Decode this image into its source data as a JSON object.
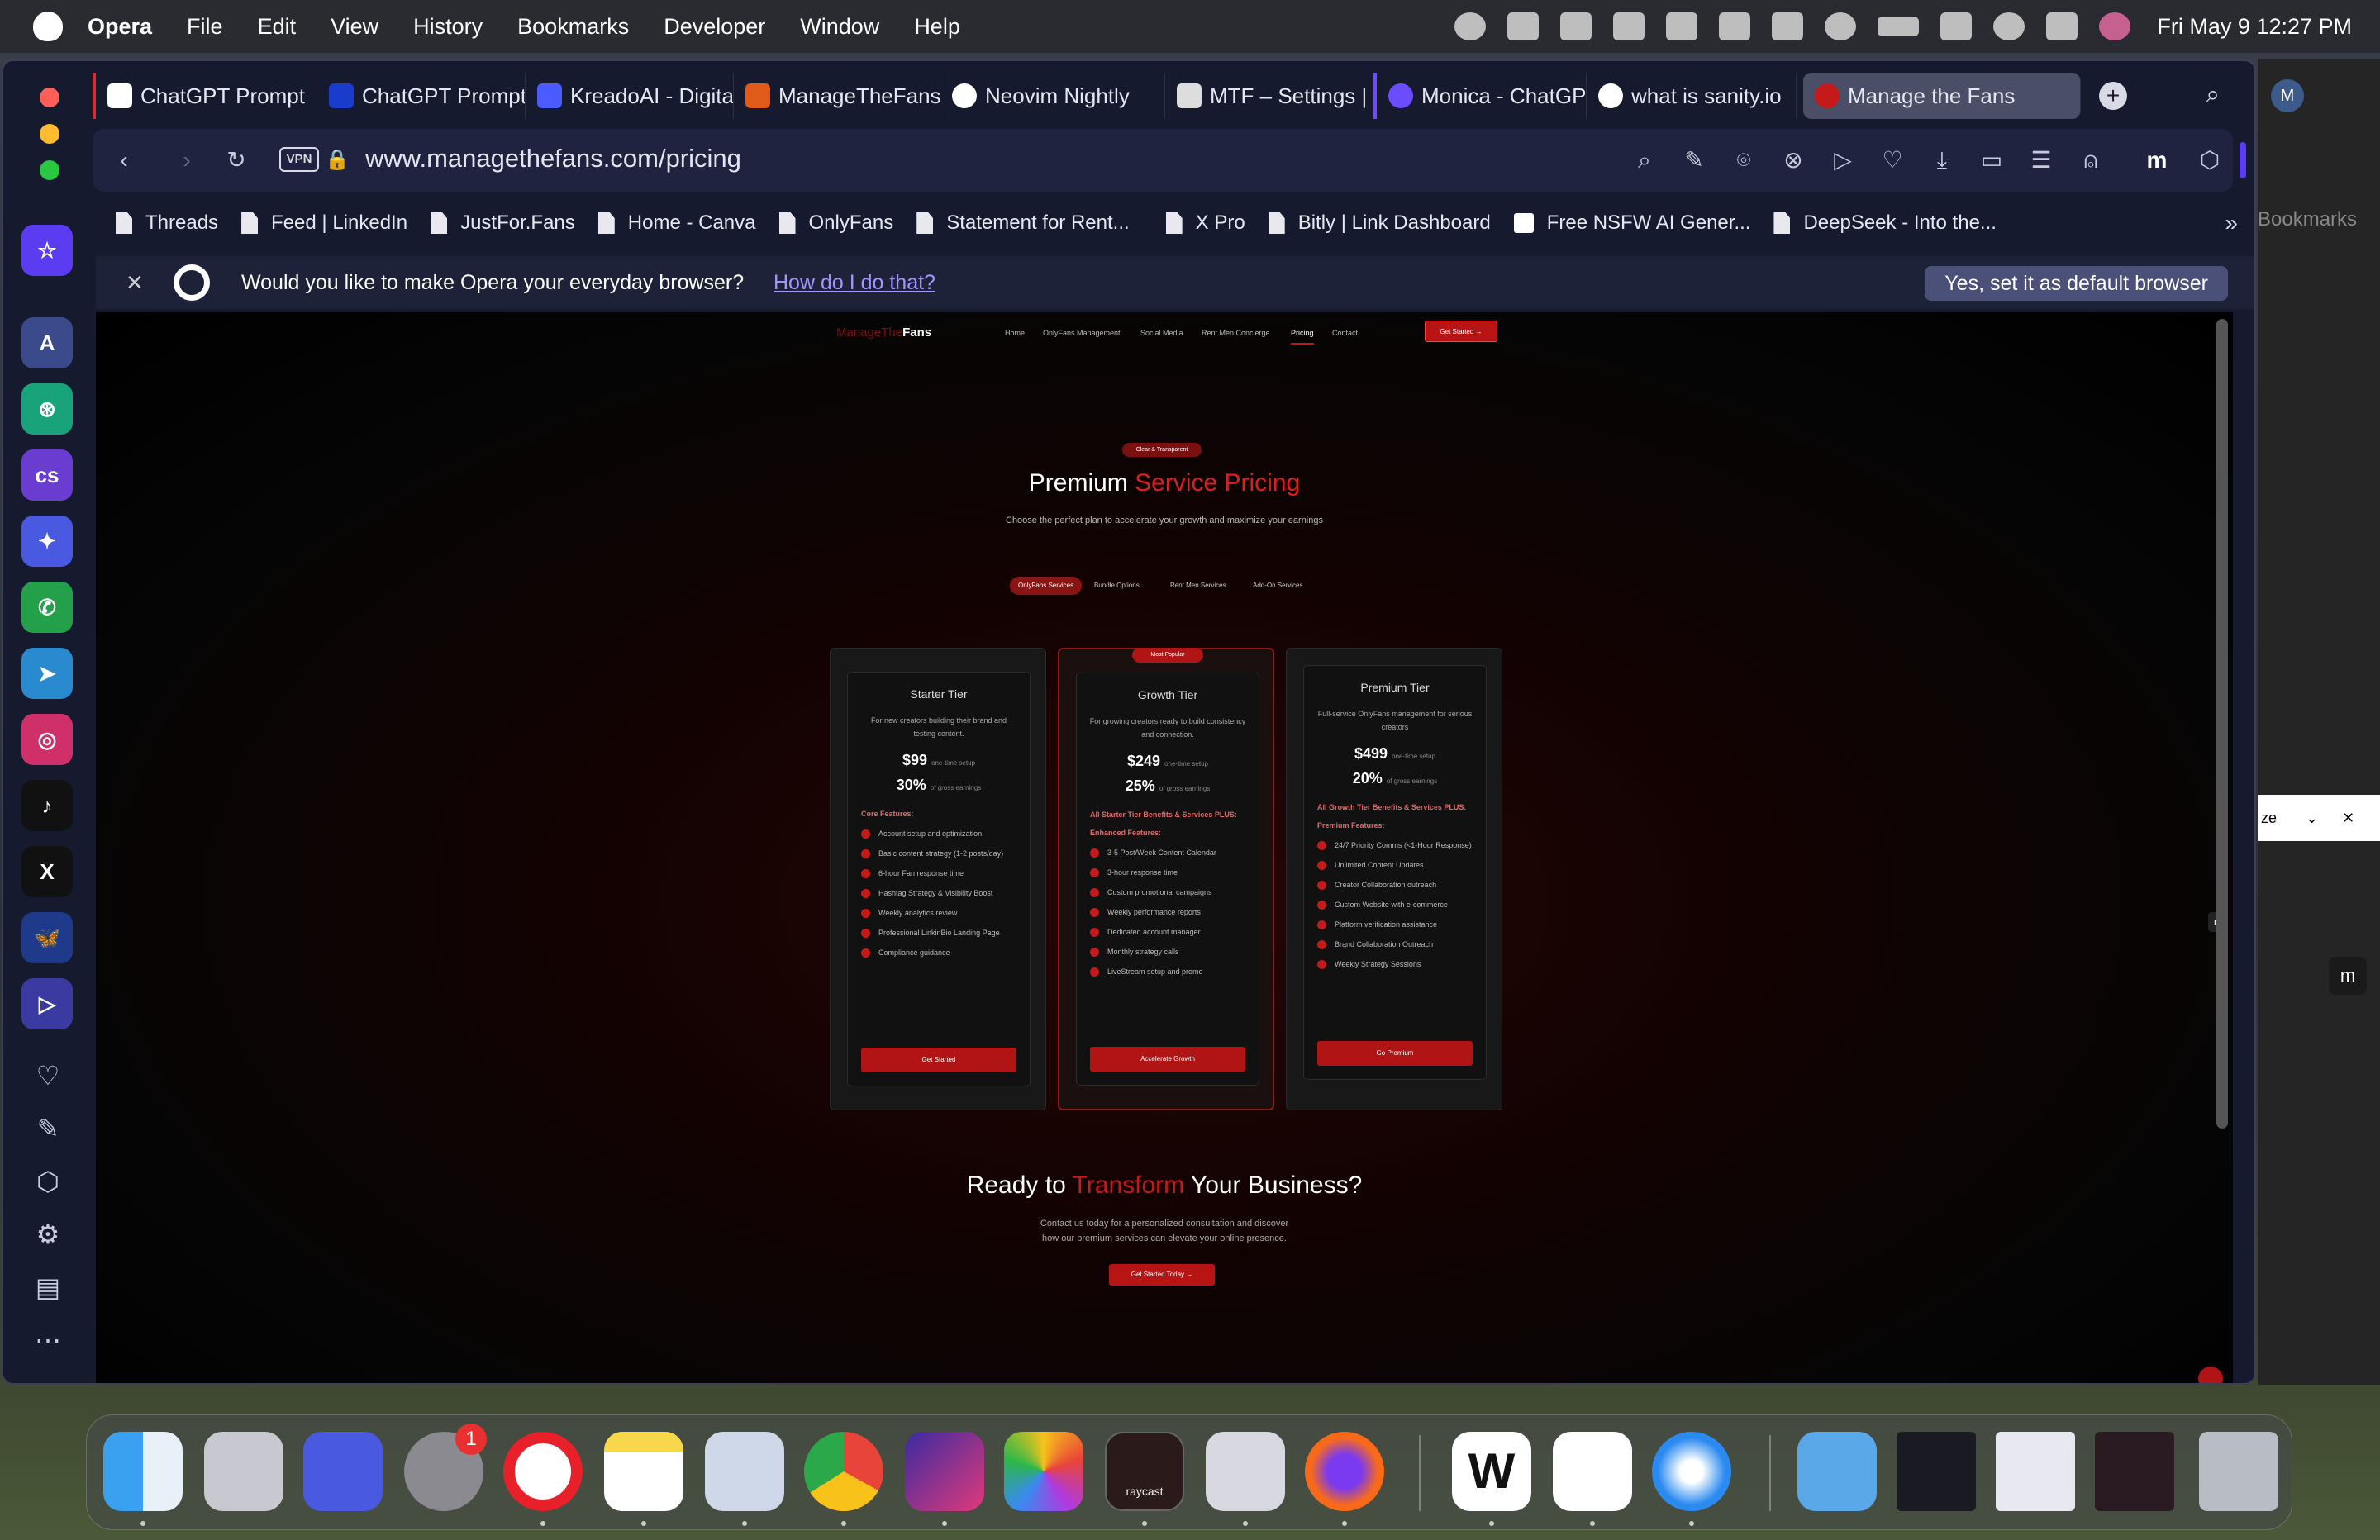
{
  "menubar": {
    "app": "Opera",
    "items": [
      "File",
      "Edit",
      "View",
      "History",
      "Bookmarks",
      "Developer",
      "Window",
      "Help"
    ],
    "clock": "Fri May 9  12:27 PM"
  },
  "tabs": [
    {
      "title": "ChatGPT Prompt",
      "color": "#ffffff"
    },
    {
      "title": "ChatGPT Prompt",
      "color": "#1a3ccc"
    },
    {
      "title": "KreadoAI - Digita",
      "color": "#4a5cff"
    },
    {
      "title": "ManageTheFans",
      "color": "#e05a1a"
    },
    {
      "title": "Neovim Nightly",
      "color": "#ffffff"
    },
    {
      "title": "MTF – Settings |",
      "color": "#dddddd"
    },
    {
      "title": "Monica - ChatGP",
      "color": "#6b4cff"
    },
    {
      "title": "what is sanity.io",
      "color": "#ffffff"
    },
    {
      "title": "Manage the Fans",
      "color": "#c41a1a"
    }
  ],
  "toolbar": {
    "vpn": "VPN",
    "url": "www.managethefans.com/pricing"
  },
  "bookmarks": [
    "Threads",
    "Feed | LinkedIn",
    "JustFor.Fans",
    "Home - Canva",
    "OnlyFans",
    "Statement for Rent...",
    "X Pro",
    "Bitly | Link Dashboard",
    "Free NSFW AI Gener...",
    "DeepSeek - Into the..."
  ],
  "notify": {
    "message": "Would you like to make Opera your everyday browser?",
    "link": "How do I do that?",
    "button": "Yes, set it as default browser"
  },
  "site": {
    "logo_a": "ManageThe",
    "logo_b": "Fans",
    "nav": [
      "Home",
      "OnlyFans Management",
      "Social Media",
      "Rent.Men Concierge",
      "Pricing",
      "Contact"
    ],
    "cta": "Get Started →",
    "badge": "Clear & Transparent",
    "title_a": "Premium ",
    "title_b": "Service Pricing",
    "subtitle": "Choose the perfect plan to accelerate your growth and maximize your earnings",
    "pricing_tabs": [
      "OnlyFans Services",
      "Bundle Options",
      "Rent.Men Services",
      "Add-On Services"
    ],
    "cards": [
      {
        "name": "Starter Tier",
        "desc": "For new creators building their brand and testing content.",
        "price": "$99",
        "price_note": "one-time setup",
        "pct": "30%",
        "pct_note": "of gross earnings",
        "heading": "Core Features:",
        "features": [
          "Account setup and optimization",
          "Basic content strategy (1-2 posts/day)",
          "6-hour Fan response time",
          "Hashtag Strategy & Visibility Boost",
          "Weekly analytics review",
          "Professional LinkinBio Landing Page",
          "Compliance guidance"
        ],
        "button": "Get Started"
      },
      {
        "name": "Growth Tier",
        "popular": "Most Popular",
        "desc": "For growing creators ready to build consistency and connection.",
        "price": "$249",
        "price_note": "one-time setup",
        "pct": "25%",
        "pct_note": "of gross earnings",
        "heading": "All Starter Tier Benefits & Services PLUS:",
        "heading2": "Enhanced Features:",
        "features": [
          "3-5 Post/Week Content Calendar",
          "3-hour response time",
          "Custom promotional campaigns",
          "Weekly performance reports",
          "Dedicated account manager",
          "Monthly strategy calls",
          "LiveStream setup and promo"
        ],
        "button": "Accelerate Growth"
      },
      {
        "name": "Premium Tier",
        "desc": "Full-service OnlyFans management for serious creators",
        "price": "$499",
        "price_note": "one-time setup",
        "pct": "20%",
        "pct_note": "of gross earnings",
        "heading": "All Growth Tier Benefits & Services PLUS:",
        "heading2": "Premium Features:",
        "features": [
          "24/7 Priority Comms (<1-Hour Response)",
          "Unlimited Content Updates",
          "Creator Collaboration outreach",
          "Custom Website with e-commerce",
          "Platform verification assistance",
          "Brand Collaboration Outreach",
          "Weekly Strategy Sessions"
        ],
        "button": "Go Premium"
      }
    ],
    "cta_title_a": "Ready to ",
    "cta_title_b": "Transform",
    "cta_title_c": " Your Business?",
    "cta_text_1": "Contact us today for a personalized consultation and discover",
    "cta_text_2": "how our premium services can elevate your online presence.",
    "cta_button": "Get Started Today →"
  },
  "right_peek": {
    "text": "Bookmarks",
    "avatar": "M",
    "partial": "ze"
  },
  "dock": {
    "badge": "1",
    "raycast_label": "raycast"
  }
}
